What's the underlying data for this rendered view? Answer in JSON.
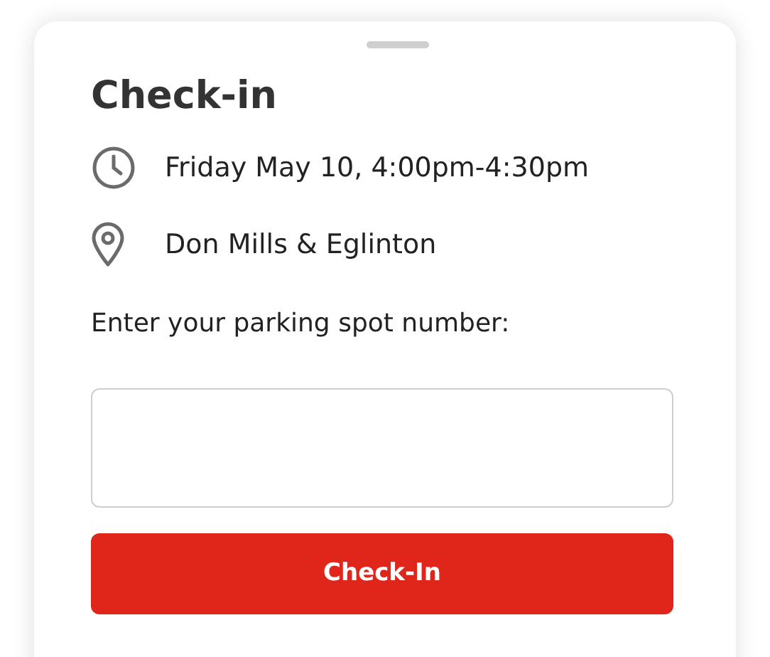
{
  "title": "Check-in",
  "details": [
    {
      "kind": "time",
      "text": "Friday May 10, 4:00pm-4:30pm"
    },
    {
      "kind": "location",
      "text": "Don Mills & Eglinton"
    }
  ],
  "spot_field": {
    "label": "Enter your parking spot number:"
  },
  "button": {
    "label": "Check-In"
  }
}
